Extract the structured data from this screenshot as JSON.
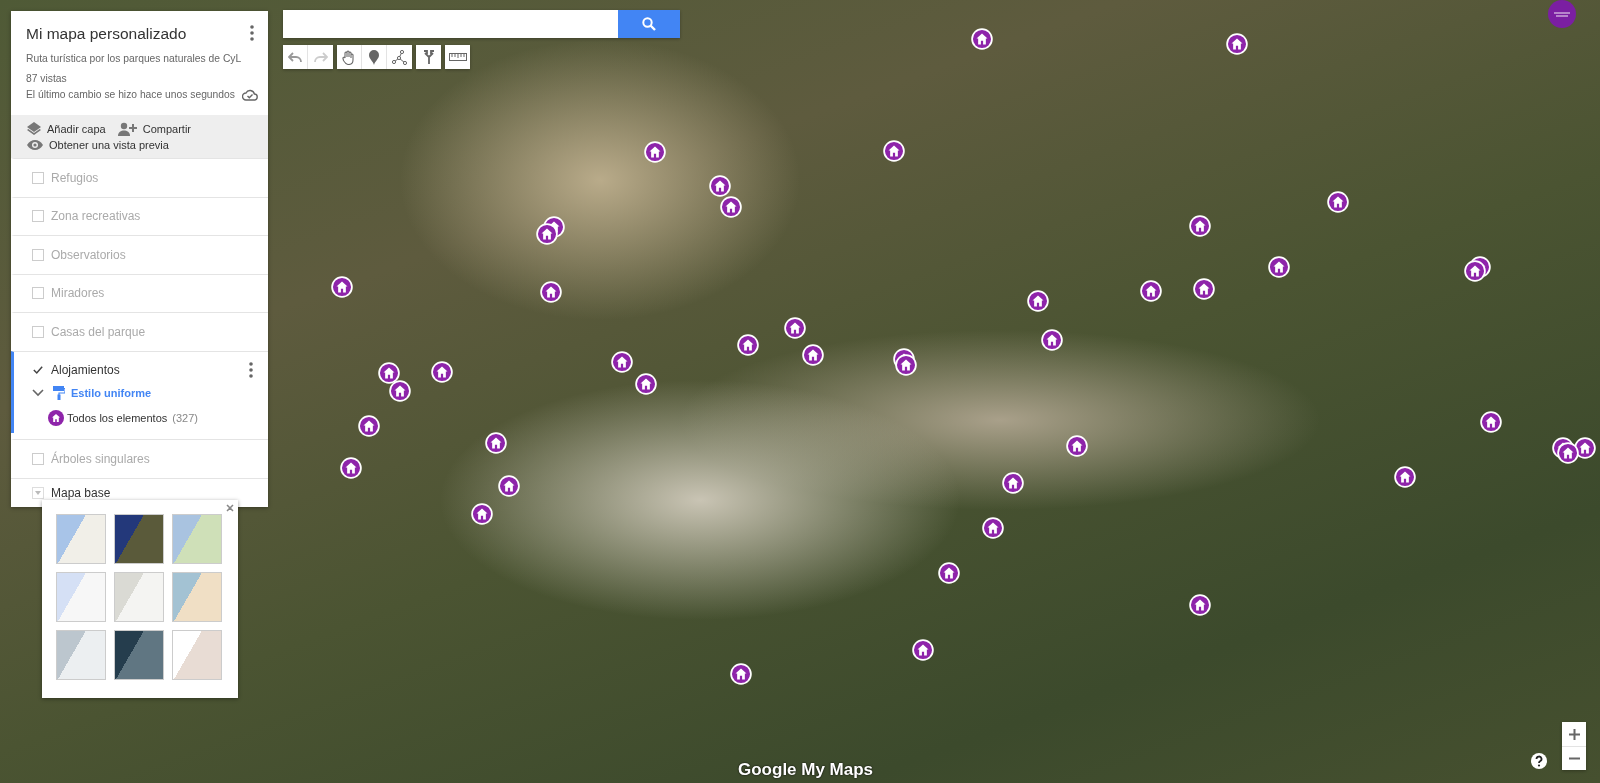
{
  "panel": {
    "title": "Mi mapa personalizado",
    "description": "Ruta turística por los parques naturales de CyL",
    "views": "87 vistas",
    "last_change": "El último cambio se hizo hace unos segundos"
  },
  "actions": [
    {
      "kind": "layer",
      "label": "Añadir capa"
    },
    {
      "kind": "share",
      "label": "Compartir"
    },
    {
      "kind": "preview",
      "label": "Obtener una vista previa"
    }
  ],
  "layers": [
    {
      "name": "Refugios",
      "checked": false,
      "selected": false
    },
    {
      "name": "Zona recreativas",
      "checked": false,
      "selected": false
    },
    {
      "name": "Observatorios",
      "checked": false,
      "selected": false
    },
    {
      "name": "Miradores",
      "checked": false,
      "selected": false
    },
    {
      "name": "Casas del parque",
      "checked": false,
      "selected": false
    },
    {
      "name": "Alojamientos",
      "checked": true,
      "selected": true,
      "expanded": true,
      "style": "Estilo uniforme",
      "group": "Todos los elementos",
      "count": "(327)"
    },
    {
      "name": "Árboles singulares",
      "checked": false,
      "selected": false
    }
  ],
  "base_map": {
    "label": "Mapa base"
  },
  "attribution": "Google My Maps"
}
